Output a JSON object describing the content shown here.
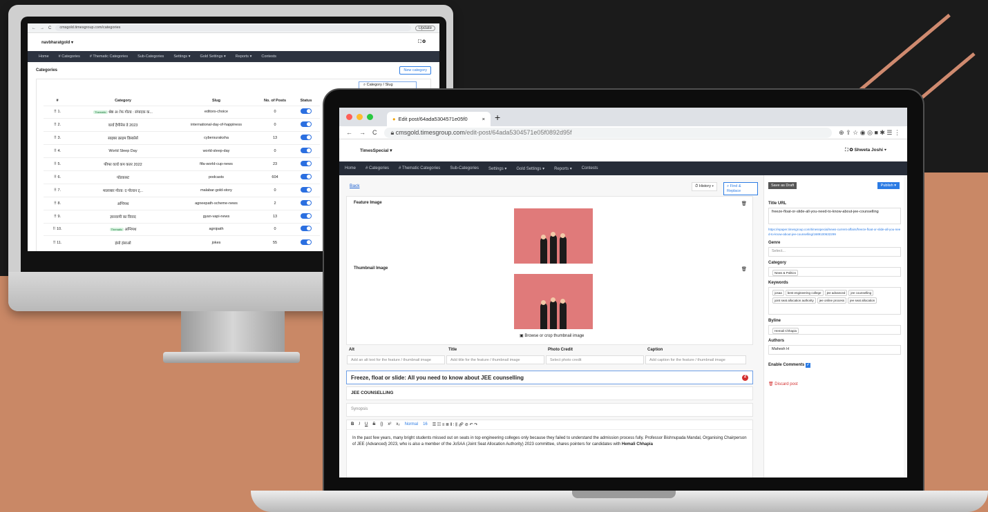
{
  "imac": {
    "address": "cmsgold.timesgroup.com/categories",
    "update": "Update",
    "brand": "navbharatgold ▾",
    "nav": [
      "Home",
      "# Categories",
      "# Thematic Categories",
      "Sub-Categories",
      "Settings ▾",
      "Gold Settings ▾",
      "Reports ▾",
      "Contests"
    ],
    "heading": "Categories",
    "new_category": "New category",
    "search_placeholder": "Category / Slug",
    "columns": [
      "#",
      "Category",
      "Slug",
      "No. of Posts",
      "Status"
    ],
    "rows": [
      {
        "n": "1.",
        "tag": "Thematic",
        "cat": "श्रेष्ठ अॉफ गोल्ड : संपादक क...",
        "slug": "editors-choice",
        "posts": "0"
      },
      {
        "n": "2.",
        "tag": "",
        "cat": "वर्ल्ड हैपीनेस डे 2023",
        "slug": "international-day-of-happiness",
        "posts": "0"
      },
      {
        "n": "3.",
        "tag": "",
        "cat": "साइबर क्राइम डिस्कोर्स",
        "slug": "cybersuraksha",
        "posts": "13"
      },
      {
        "n": "4.",
        "tag": "",
        "cat": "World Sleep Day",
        "slug": "world-sleep-day",
        "posts": "0"
      },
      {
        "n": "5.",
        "tag": "",
        "cat": "फीफा वर्ल्ड कप कतर 2022",
        "slug": "fifa-world-cup-news",
        "posts": "23"
      },
      {
        "n": "6.",
        "tag": "",
        "cat": "पॉडकास्ट",
        "slug": "podcasts",
        "posts": "604"
      },
      {
        "n": "7.",
        "tag": "",
        "cat": "मालाबार गोल्ड: द गोल्डन ट्...",
        "slug": "malabar-gold-story",
        "posts": "0"
      },
      {
        "n": "8.",
        "tag": "",
        "cat": "अग्निपथ",
        "slug": "agneepath-scheme-news",
        "posts": "2"
      },
      {
        "n": "9.",
        "tag": "",
        "cat": "ज्ञानवापी का विवाद",
        "slug": "gyan-vapi-news",
        "posts": "13"
      },
      {
        "n": "10.",
        "tag": "Thematic",
        "cat": "अग्निपथ",
        "slug": "agnipath",
        "posts": "0"
      },
      {
        "n": "11.",
        "tag": "",
        "cat": "हंसो हंसाओ",
        "slug": "jokes",
        "posts": "55"
      }
    ]
  },
  "laptop": {
    "tab_title": "Edit post/64ada5304571e05f0",
    "new_tab": "+",
    "url_host": "cmsgold.timesgroup.com",
    "url_path": "/edit-post/64ada5304571e05f0892d95f",
    "brand": "TimesSpecial ▾",
    "user": "Shweta Joshi ▾",
    "nav": [
      "Home",
      "# Categories",
      "# Thematic Categories",
      "Sub-Categories",
      "Settings ▾",
      "Gold Settings ▾",
      "Reports ▾",
      "Contests"
    ],
    "back": "Back",
    "history": "History ▾",
    "find_replace": "Find & Replace",
    "feature_image": "Feature Image",
    "thumbnail_image": "Thumbnail Image",
    "browse_crop": "Browse or crop thumbnail image",
    "meta_labels": [
      "Alt",
      "Title",
      "Photo Credit",
      "Caption"
    ],
    "meta_placeholders": [
      "Add an alt text for the feature / thumbnail image",
      "Add title for the feature / thumbnail image",
      "Select photo credit",
      "Add caption for the feature / thumbnail image"
    ],
    "headline": "Freeze, float or slide: All you need to know about JEE counselling",
    "headline_badge": "2",
    "kicker": "JEE COUNSELLING",
    "synopsis_placeholder": "Synopsis",
    "editor_style": "Normal",
    "editor_size": "16",
    "body_text": "In the past few years, many bright students missed out on seats in top engineering colleges only because they failed to understand the admission process fully. Professor Bishnupada Mandal, Organising Chairperson of JEE (Advanced) 2023, who is also a member of the JoSAA (Joint Seat Allocation Authority) 2023 committee, shares pointers for candidates with",
    "body_bold": "Hemali Chhapia",
    "save_draft": "Save as Draft",
    "publish": "Publish ▾",
    "title_url_label": "Title URL",
    "title_url": "freeze-float-or-slide-all-you-need-to-know-about-jee-counselling",
    "full_url": "https://epaper.timesgroup.com/timesspecial/news-current-affairs/freeze-float-or-slide-all-you-need-to-know-about-jee-counselling/1689100632299",
    "genre_label": "Genre",
    "genre_placeholder": "Select...",
    "category_label": "Category",
    "category_value": "News & Politics",
    "keywords_label": "Keywords",
    "keywords": [
      "josaa",
      "best engineering college",
      "jee advanced",
      "jee counselling",
      "joint seat allocation authority",
      "jee online process",
      "jee seat allocation"
    ],
    "byline_label": "Byline",
    "byline_value": "Hemali Chhapia",
    "authors_label": "Authors",
    "authors_value": "Mahesh H",
    "enable_comments": "Enable Comments",
    "discard": "Discard post"
  }
}
